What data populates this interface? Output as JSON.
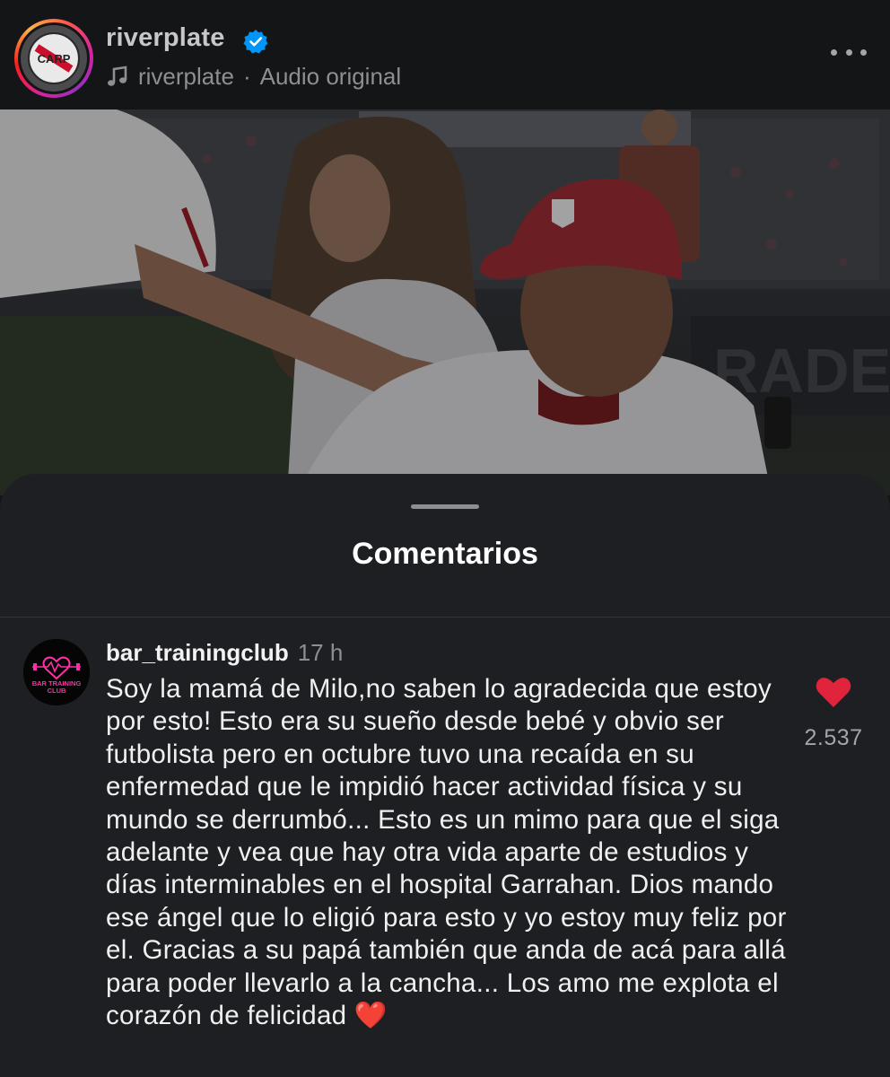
{
  "header": {
    "username": "riverplate",
    "audio_owner": "riverplate",
    "audio_separator": "·",
    "audio_label": "Audio original",
    "avatar_logo_text": "CARP",
    "icons": {
      "verified": "verified-badge-icon",
      "audio": "music-note-icon",
      "more": "more-horizontal-icon"
    }
  },
  "sheet": {
    "title": "Comentarios"
  },
  "comment": {
    "username": "bar_trainingclub",
    "time": "17 h",
    "avatar_logo_text": "BAR TRAINING CLUB",
    "text": "Soy la mamá de Milo,no saben lo agradecida que estoy por esto! Esto era su sueño desde bebé y obvio ser futbolista pero en octubre tuvo una recaída en su enfermedad que le impidió hacer actividad física y su mundo se derrumbó... Esto es un mimo para que el siga adelante y vea que hay otra vida aparte de estudios y días interminables en el hospital Garrahan. Dios mando ese ángel que lo eligió para esto y yo estoy muy feliz por el. Gracias a su papá también que anda de acá para allá para poder llevarlo a la cancha... Los amo me explota el corazón de felicidad",
    "emoji": "❤️",
    "likes": "2.537",
    "liked": true
  },
  "colors": {
    "accent_heart": "#e0243b",
    "verified_blue": "#0095f6",
    "club_red": "#c8102e",
    "neon_pink": "#ff2fa8"
  }
}
